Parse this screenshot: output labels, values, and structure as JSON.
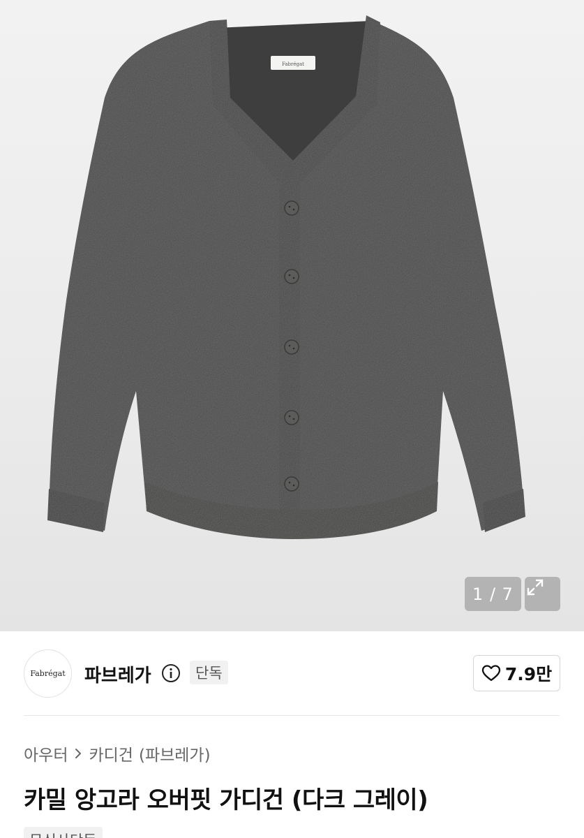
{
  "gallery": {
    "counter": "1 / 7",
    "label_tag": "Fabrégat"
  },
  "brand": {
    "logo_text": "Fabrégat",
    "name": "파브레가",
    "exclusive_badge": "단독"
  },
  "like": {
    "count": "7.9만"
  },
  "breadcrumb": {
    "category": "아우터",
    "subcategory": "카디건",
    "brand": "(파브레가)"
  },
  "product": {
    "title": "카밀 앙고라 오버핏 가디건 (다크 그레이)",
    "tag": "무신사단독"
  }
}
